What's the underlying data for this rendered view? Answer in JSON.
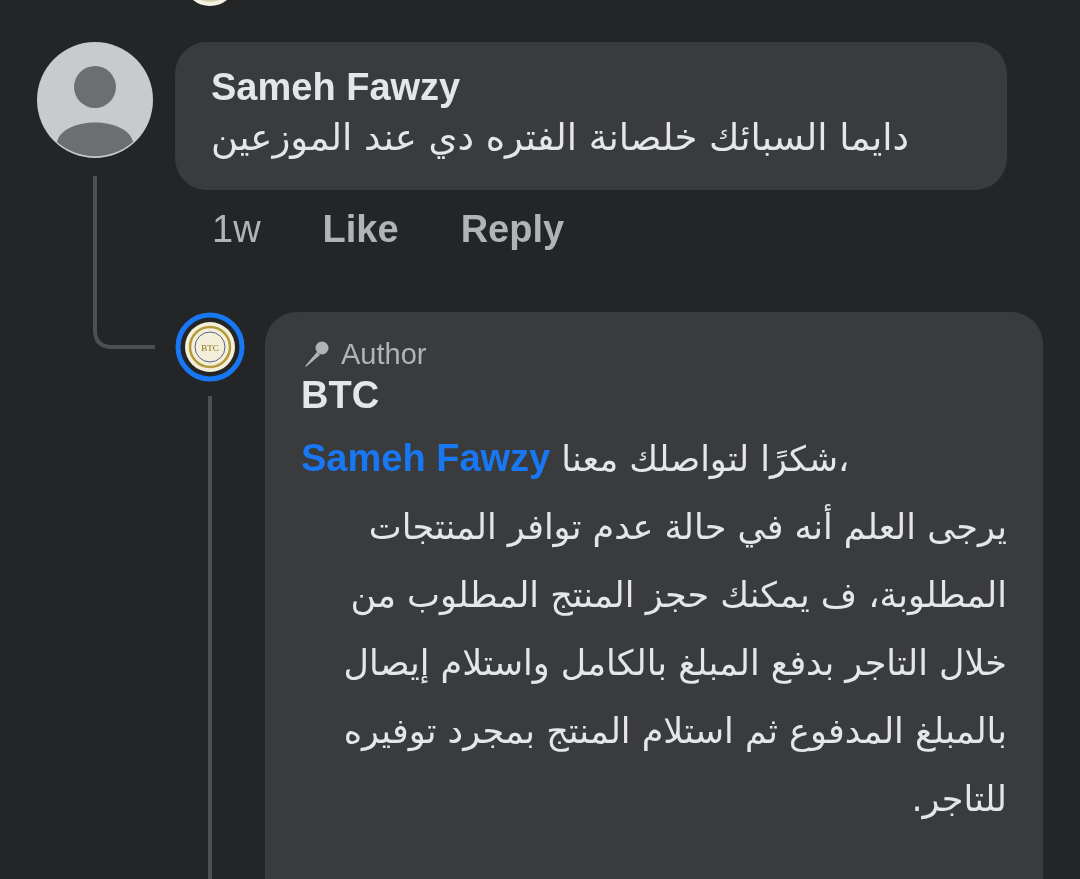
{
  "comments": [
    {
      "author": "Sameh Fawzy",
      "text": "دايما السبائك خلصانة الفتره دي عند الموزعين",
      "time": "1w",
      "like_label": "Like",
      "reply_label": "Reply",
      "replies": [
        {
          "badge": "Author",
          "author": "BTC",
          "avatar_label": "BTC",
          "mention": "Sameh Fawzy",
          "greeting": "شكرًا لتواصلك معنا،",
          "text": "يرجى العلم أنه في حالة عدم توافر المنتجات المطلوبة، ف يمكنك حجز المنتج المطلوب من خلال التاجر بدفع المبلغ بالكامل واستلام إيصال بالمبلغ المدفوع ثم استلام المنتج بمجرد توفيره للتاجر."
        }
      ]
    }
  ]
}
